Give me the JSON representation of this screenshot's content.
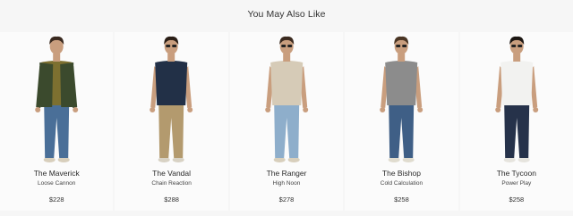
{
  "section": {
    "title": "You May Also Like"
  },
  "products": [
    {
      "name": "The Maverick",
      "collection": "Loose Cannon",
      "price": "$228",
      "top_color": "#3b4a2d",
      "inner_color": "#7d7030",
      "pants_color": "#4a6f98",
      "hair_color": "#3a2a20",
      "shoe_color": "#d8cfbc",
      "jacket": true,
      "glasses": false
    },
    {
      "name": "The Vandal",
      "collection": "Chain Reaction",
      "price": "$288",
      "top_color": "#223047",
      "inner_color": "#223047",
      "pants_color": "#b39a6e",
      "hair_color": "#2a1e16",
      "shoe_color": "#d8d2c4",
      "jacket": false,
      "glasses": true
    },
    {
      "name": "The Ranger",
      "collection": "High Noon",
      "price": "$278",
      "top_color": "#d6cbb7",
      "inner_color": "#d6cbb7",
      "pants_color": "#8eaecb",
      "hair_color": "#3b2a1f",
      "shoe_color": "#d8cfbc",
      "jacket": false,
      "glasses": true
    },
    {
      "name": "The Bishop",
      "collection": "Cold Calculation",
      "price": "$258",
      "top_color": "#8c8c8c",
      "inner_color": "#8c8c8c",
      "pants_color": "#3f5f86",
      "hair_color": "#4a3524",
      "shoe_color": "#e0dccf",
      "jacket": false,
      "glasses": true
    },
    {
      "name": "The Tycoon",
      "collection": "Power Play",
      "price": "$258",
      "top_color": "#f2f2f0",
      "inner_color": "#f2f2f0",
      "pants_color": "#26324a",
      "hair_color": "#1c1612",
      "shoe_color": "#e6e4de",
      "jacket": false,
      "glasses": true
    }
  ]
}
